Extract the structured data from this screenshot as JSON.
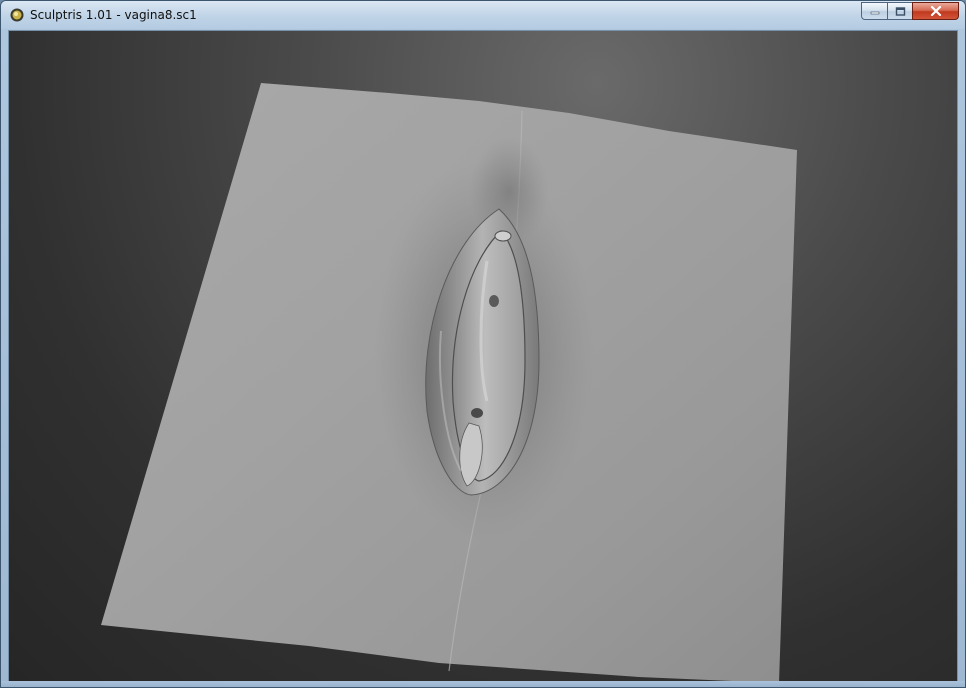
{
  "window": {
    "title": "Sculptris 1.01 - vagina8.sc1"
  },
  "caption_buttons": {
    "minimize": "minimize",
    "maximize": "maximize",
    "close": "close"
  },
  "icons": {
    "app": "sculptris-app-icon",
    "minimize": "minimize-icon",
    "maximize": "maximize-icon",
    "close": "close-icon"
  },
  "colors": {
    "viewport_background": "#2a2a2a",
    "mesh_surface": "#9a9a9a",
    "title_bar": "#c2d5e8",
    "close_button": "#c0391e"
  }
}
